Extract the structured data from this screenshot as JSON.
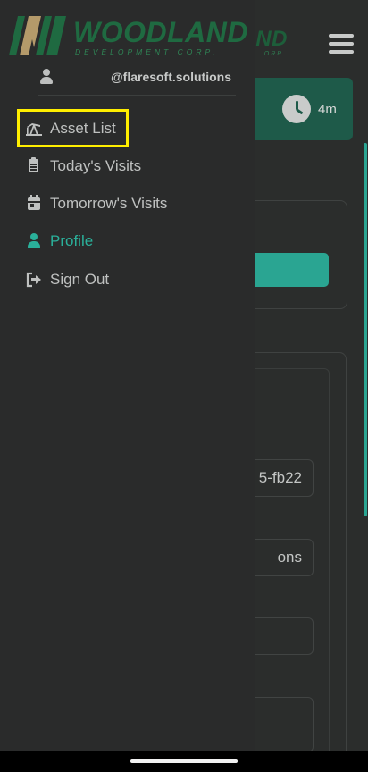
{
  "background_app": {
    "brand_partial": "ND",
    "brand_sub_partial": "ORP.",
    "timer": "4m",
    "fields": [
      "5-fb22",
      "ons",
      "",
      ""
    ]
  },
  "drawer": {
    "brand": "WOODLAND",
    "brand_sub": "DEVELOPMENT CORP.",
    "user_handle": "@flaresoft.solutions",
    "items": [
      {
        "label": "Asset List",
        "icon": "pumpjack-icon",
        "active": false,
        "highlighted": true
      },
      {
        "label": "Today's Visits",
        "icon": "clipboard-icon",
        "active": false
      },
      {
        "label": "Tomorrow's Visits",
        "icon": "calendar-icon",
        "active": false
      },
      {
        "label": "Profile",
        "icon": "user-icon",
        "active": true
      },
      {
        "label": "Sign Out",
        "icon": "sign-out-icon",
        "active": false
      }
    ]
  },
  "colors": {
    "accent": "#2ab09a",
    "brand_green": "#1f6a41",
    "highlight": "#ffee00"
  }
}
